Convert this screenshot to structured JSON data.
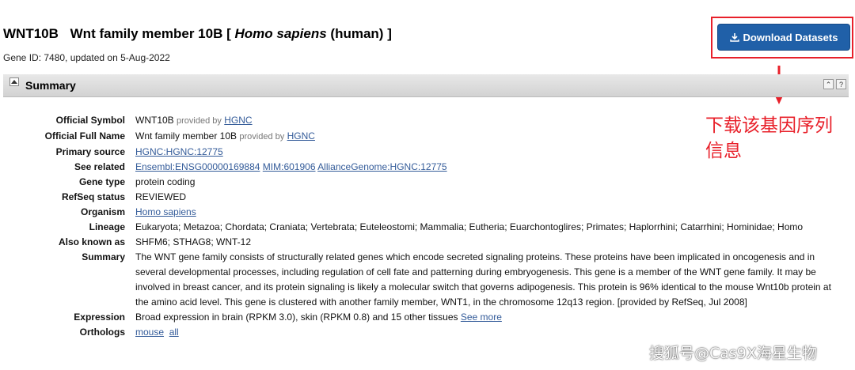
{
  "header": {
    "symbol": "WNT10B",
    "name_prefix": "Wnt family member 10B [",
    "organism_italic": "Homo sapiens",
    "name_suffix": "(human) ]",
    "subline": "Gene ID: 7480, updated on 5-Aug-2022"
  },
  "download_button": {
    "label": "Download Datasets",
    "icon": "download-icon"
  },
  "annotation": {
    "text": "下载该基因序列信息",
    "color": "#e8202a"
  },
  "summary_section": {
    "title": "Summary"
  },
  "provided_by": "provided by",
  "rows": {
    "official_symbol": {
      "label": "Official Symbol",
      "value": "WNT10B",
      "link": "HGNC"
    },
    "official_full_name": {
      "label": "Official Full Name",
      "value": "Wnt family member 10B",
      "link": "HGNC"
    },
    "primary_source": {
      "label": "Primary source",
      "link": "HGNC:HGNC:12775"
    },
    "see_related": {
      "label": "See related",
      "links": [
        "Ensembl:ENSG00000169884",
        "MIM:601906",
        "AllianceGenome:HGNC:12775"
      ]
    },
    "gene_type": {
      "label": "Gene type",
      "value": "protein coding"
    },
    "refseq_status": {
      "label": "RefSeq status",
      "value": "REVIEWED"
    },
    "organism": {
      "label": "Organism",
      "link": "Homo sapiens"
    },
    "lineage": {
      "label": "Lineage",
      "value": "Eukaryota; Metazoa; Chordata; Craniata; Vertebrata; Euteleostomi; Mammalia; Eutheria; Euarchontoglires; Primates; Haplorrhini; Catarrhini; Hominidae; Homo"
    },
    "also_known_as": {
      "label": "Also known as",
      "value": "SHFM6; STHAG8; WNT-12"
    },
    "summary": {
      "label": "Summary",
      "value": "The WNT gene family consists of structurally related genes which encode secreted signaling proteins. These proteins have been implicated in oncogenesis and in several developmental processes, including regulation of cell fate and patterning during embryogenesis. This gene is a member of the WNT gene family. It may be involved in breast cancer, and its protein signaling is likely a molecular switch that governs adipogenesis. This protein is 96% identical to the mouse Wnt10b protein at the amino acid level. This gene is clustered with another family member, WNT1, in the chromosome 12q13 region. [provided by RefSeq, Jul 2008]"
    },
    "expression": {
      "label": "Expression",
      "value": "Broad expression in brain (RPKM 3.0), skin (RPKM 0.8) and 15 other tissues",
      "link": "See more"
    },
    "orthologs": {
      "label": "Orthologs",
      "links": [
        "mouse",
        "all"
      ]
    }
  },
  "watermark": "搜狐号@Cas9X海星生物",
  "colors": {
    "button": "#2060a8",
    "link": "#335b99",
    "annotation_red": "#e8202a"
  }
}
